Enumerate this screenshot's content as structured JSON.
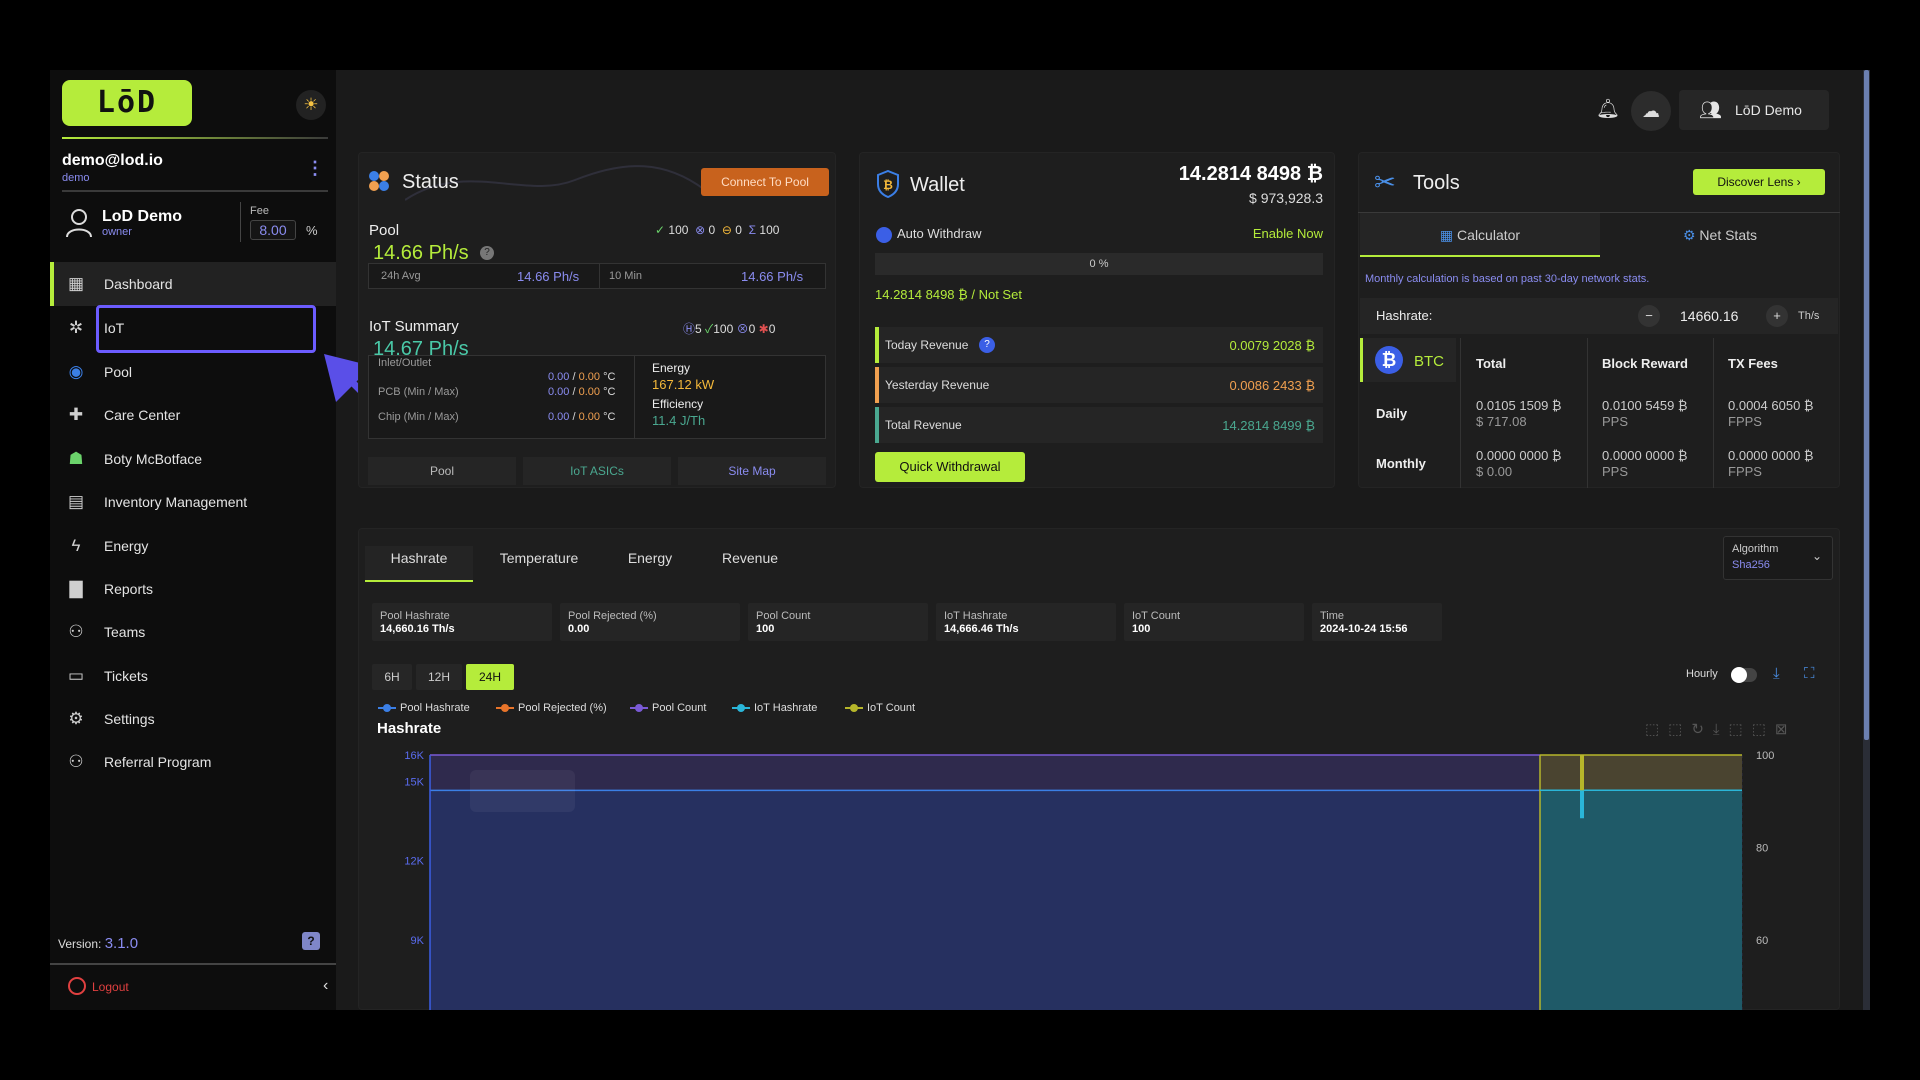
{
  "sidebar": {
    "logo": "LōD",
    "user": {
      "email": "demo@lod.io",
      "username": "demo"
    },
    "account": {
      "name": "LoD Demo",
      "role": "owner",
      "fee_label": "Fee",
      "fee_value": "8.00",
      "fee_unit": "%"
    },
    "nav": [
      {
        "label": "Dashboard",
        "icon": "grid-icon",
        "active": true
      },
      {
        "label": "IoT",
        "icon": "network-icon"
      },
      {
        "label": "Pool",
        "icon": "pool-icon"
      },
      {
        "label": "Care Center",
        "icon": "medical-bag-icon"
      },
      {
        "label": "Boty McBotface",
        "icon": "robot-icon"
      },
      {
        "label": "Inventory Management",
        "icon": "inventory-icon"
      },
      {
        "label": "Energy",
        "icon": "lightning-icon"
      },
      {
        "label": "Reports",
        "icon": "report-icon"
      },
      {
        "label": "Teams",
        "icon": "teams-icon"
      },
      {
        "label": "Tickets",
        "icon": "ticket-icon"
      },
      {
        "label": "Settings",
        "icon": "gear-icon"
      },
      {
        "label": "Referral Program",
        "icon": "referral-icon"
      }
    ],
    "version_label": "Version:",
    "version": "3.1.0",
    "logout": "Logout"
  },
  "header": {
    "user_button": "LōD Demo"
  },
  "status": {
    "title": "Status",
    "connect_button": "Connect To Pool",
    "pool_label": "Pool",
    "pool_counts": [
      "100",
      "0",
      "0",
      "100"
    ],
    "pool_hashrate": "14.66 Ph/s",
    "avg24_label": "24h Avg",
    "avg24_value": "14.66 Ph/s",
    "min10_label": "10 Min",
    "min10_value": "14.66 Ph/s",
    "iot_label": "IoT Summary",
    "iot_counts": [
      "5",
      "100",
      "0",
      "0"
    ],
    "iot_hashrate": "14.67 Ph/s",
    "temps": [
      {
        "label": "Inlet/Outlet",
        "min": "0.00",
        "max": "0.00",
        "unit": "°C"
      },
      {
        "label": "PCB (Min / Max)",
        "min": "0.00",
        "max": "0.00",
        "unit": "°C"
      },
      {
        "label": "Chip (Min / Max)",
        "min": "0.00",
        "max": "0.00",
        "unit": "°C"
      }
    ],
    "energy_label": "Energy",
    "energy_value": "167.12 kW",
    "efficiency_label": "Efficiency",
    "efficiency_value": "11.4 J/Th",
    "buttons": [
      "Pool",
      "IoT ASICs",
      "Site Map"
    ]
  },
  "wallet": {
    "title": "Wallet",
    "balance_btc": "14.2814 8498 ₿",
    "balance_usd": "$ 973,928.3",
    "auto_withdraw_label": "Auto Withdraw",
    "enable_now": "Enable Now",
    "progress_text": "0 %",
    "progress": 0,
    "threshold_text": "14.2814 8498 ₿ / Not Set",
    "rows": [
      {
        "label": "Today Revenue",
        "value": "0.0079 2028 ₿",
        "color": "#b5ec3b"
      },
      {
        "label": "Yesterday Revenue",
        "value": "0.0086 2433 ₿",
        "color": "#f0a050"
      },
      {
        "label": "Total Revenue",
        "value": "14.2814 8499 ₿",
        "color": "#4aa890"
      }
    ],
    "quick_withdrawal": "Quick Withdrawal"
  },
  "tools": {
    "title": "Tools",
    "discover_button": "Discover Lens",
    "tabs": [
      "Calculator",
      "Net Stats"
    ],
    "note": "Monthly calculation is based on past 30-day network stats.",
    "hashrate_label": "Hashrate:",
    "hashrate_value": "14660.16",
    "hashrate_unit": "Th/s",
    "coin": "BTC",
    "columns": [
      "Total",
      "Block Reward",
      "TX Fees"
    ],
    "rows": [
      {
        "label": "Daily",
        "total": "0.0105 1509 ₿",
        "total_usd": "$ 717.08",
        "block": "0.0100 5459 ₿",
        "block_sub": "PPS",
        "fees": "0.0004 6050 ₿",
        "fees_sub": "FPPS"
      },
      {
        "label": "Monthly",
        "total": "0.0000 0000 ₿",
        "total_usd": "$ 0.00",
        "block": "0.0000 0000 ₿",
        "block_sub": "PPS",
        "fees": "0.0000 0000 ₿",
        "fees_sub": "FPPS"
      }
    ]
  },
  "main": {
    "tabs": [
      "Hashrate",
      "Temperature",
      "Energy",
      "Revenue"
    ],
    "algorithm_label": "Algorithm",
    "algorithm_value": "Sha256",
    "stats": [
      {
        "title": "Pool Hashrate",
        "value": "14,660.16 Th/s"
      },
      {
        "title": "Pool Rejected (%)",
        "value": "0.00"
      },
      {
        "title": "Pool Count",
        "value": "100"
      },
      {
        "title": "IoT Hashrate",
        "value": "14,666.46 Th/s"
      },
      {
        "title": "IoT Count",
        "value": "100"
      },
      {
        "title": "Time",
        "value": "2024-10-24 15:56"
      }
    ],
    "ranges": [
      "6H",
      "12H",
      "24H"
    ],
    "hourly_label": "Hourly"
  },
  "chart_data": {
    "type": "area",
    "title": "Hashrate",
    "legend": [
      {
        "name": "Pool Hashrate",
        "color": "#3b7fe6"
      },
      {
        "name": "Pool Rejected (%)",
        "color": "#e8742a"
      },
      {
        "name": "Pool Count",
        "color": "#7a5ad6"
      },
      {
        "name": "IoT Hashrate",
        "color": "#2ab6d9"
      },
      {
        "name": "IoT Count",
        "color": "#b6b62a"
      }
    ],
    "y_left_ticks": [
      "16K",
      "15K",
      "12K",
      "9K"
    ],
    "y_right_ticks": [
      "100",
      "80",
      "60"
    ],
    "series": [
      {
        "name": "Pool Hashrate",
        "values": [
          14660,
          14660,
          14660,
          14660
        ]
      },
      {
        "name": "IoT Hashrate",
        "values": [
          14666,
          14666,
          14666,
          14666
        ]
      },
      {
        "name": "Pool Count",
        "values": [
          100,
          100,
          100,
          100
        ]
      },
      {
        "name": "IoT Count",
        "values": [
          100,
          100,
          100,
          100
        ]
      }
    ]
  }
}
